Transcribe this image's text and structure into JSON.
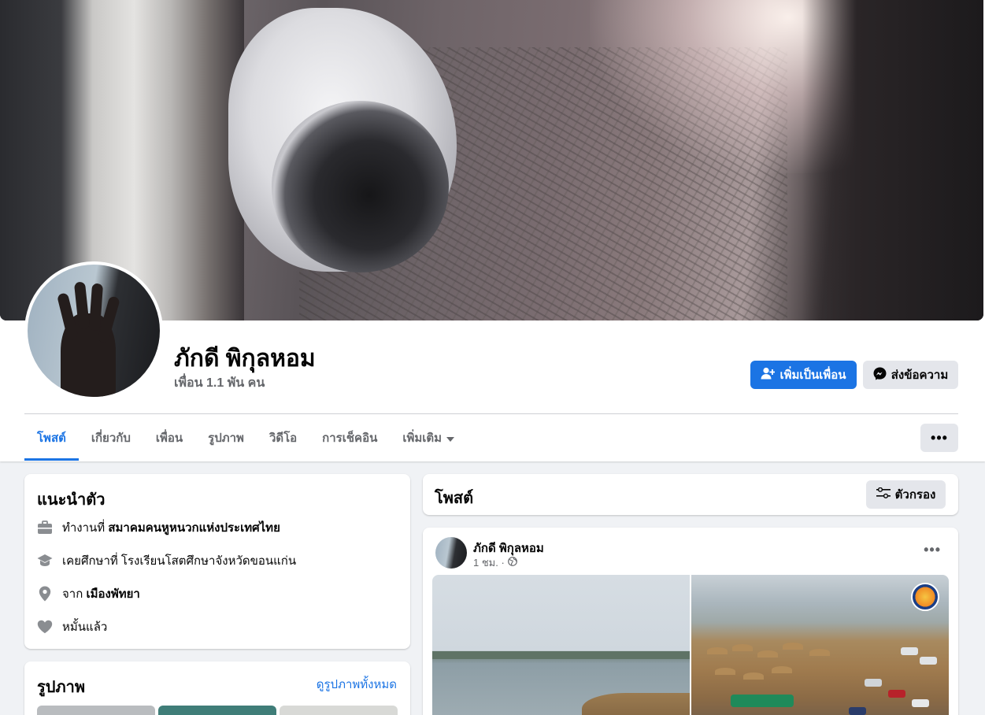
{
  "profile": {
    "name": "ภักดี พิกุลหอม",
    "friends": "เพื่อน 1.1 พัน คน"
  },
  "actions": {
    "add_friend": "เพิ่มเป็นเพื่อน",
    "message": "ส่งข้อความ",
    "more": "•••"
  },
  "tabs": [
    {
      "label": "โพสต์",
      "active": true
    },
    {
      "label": "เกี่ยวกับ",
      "active": false
    },
    {
      "label": "เพื่อน",
      "active": false
    },
    {
      "label": "รูปภาพ",
      "active": false
    },
    {
      "label": "วิดีโอ",
      "active": false
    },
    {
      "label": "การเช็คอิน",
      "active": false
    },
    {
      "label": "เพิ่มเติม",
      "active": false
    }
  ],
  "intro": {
    "title": "แนะนำตัว",
    "work_prefix": "ทำงานที่",
    "work_place": "สมาคมคนหูหนวกแห่งประเทศไทย",
    "education": "เคยศึกษาที่ โรงเรียนโสตศึกษาจังหวัดขอนแก่น",
    "from_prefix": "จาก",
    "from_place": "เมืองพัทยา",
    "relationship": "หมั้นแล้ว"
  },
  "photos": {
    "title": "รูปภาพ",
    "see_all": "ดูรูปภาพทั้งหมด"
  },
  "posts": {
    "title": "โพสต์",
    "filter": "ตัวกรอง"
  },
  "post": {
    "author": "ภักดี พิกุลหอม",
    "time": "1 ชม. ·",
    "more": "•••"
  },
  "colors": {
    "accent": "#1b74e4",
    "secondary_button": "#e4e6eb",
    "page_background": "#f0f2f5",
    "muted_text": "#65676b"
  },
  "icons": {
    "add_friend": "person-plus-icon",
    "message": "messenger-icon",
    "dropdown": "caret-down-icon",
    "work": "briefcase-icon",
    "education": "graduation-cap-icon",
    "location": "location-pin-icon",
    "relationship": "heart-icon",
    "filter": "filter-sliders-icon",
    "audience": "globe-icon"
  }
}
